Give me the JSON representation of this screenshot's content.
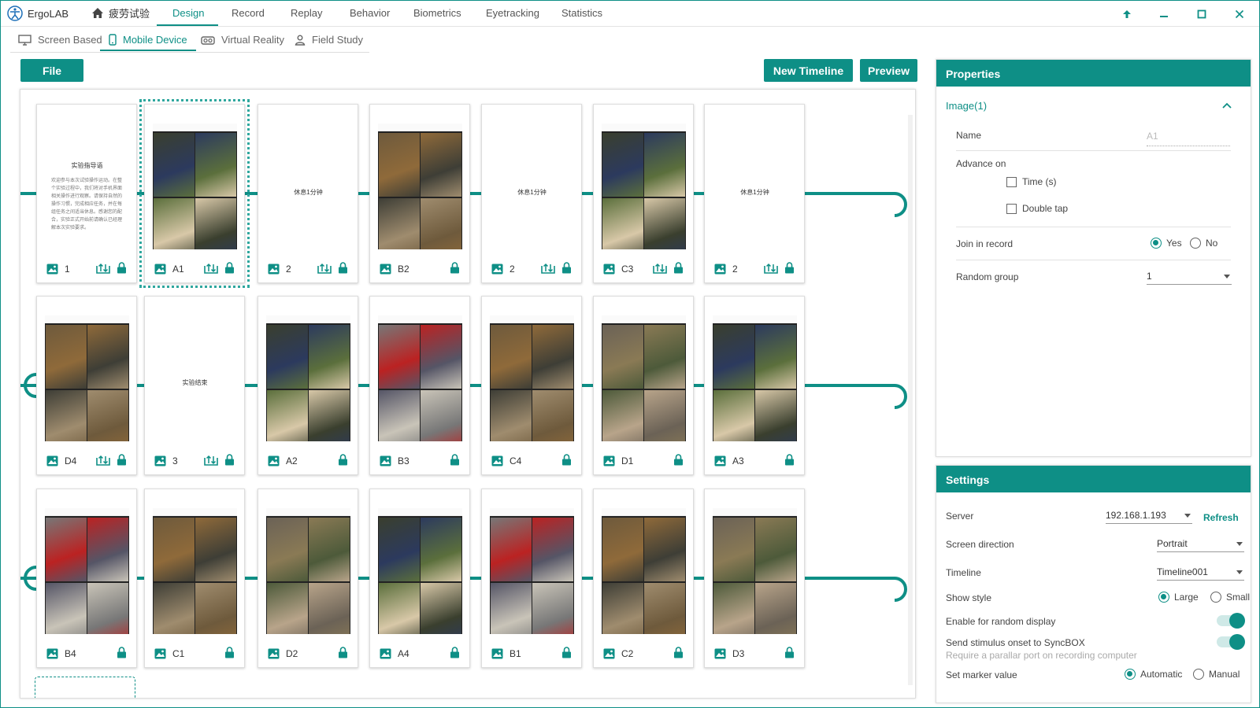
{
  "app": {
    "brand": "ErgoLAB",
    "project": "疲劳试验"
  },
  "nav": [
    "Design",
    "Record",
    "Replay",
    "Behavior",
    "Biometrics",
    "Eyetracking",
    "Statistics"
  ],
  "subtabs": [
    "Screen Based",
    "Mobile Device",
    "Virtual Reality",
    "Field Study"
  ],
  "toolbar": {
    "file": "File",
    "new_timeline": "New Timeline",
    "preview": "Preview"
  },
  "cards": {
    "row1": [
      "1",
      "A1",
      "2",
      "B2",
      "2",
      "C3",
      "2"
    ],
    "row2": [
      "D4",
      "3",
      "A2",
      "B3",
      "C4",
      "D1",
      "A3"
    ],
    "row3": [
      "B4",
      "C1",
      "D2",
      "A4",
      "B1",
      "C2",
      "D3"
    ]
  },
  "slide_text": {
    "intro_title": "实验指导语",
    "intro_body": "欢迎参与本次试验操作运动。在整个实验过程中，我们将对手机界面相关操作进行观察。请保持自然的操作习惯，完成相应任务，并在每组任务之间适当休息。感谢您的配合，实验正式开始前请确认已经理解本次实验要求。",
    "rest": "休息1分钟",
    "end": "实验结束"
  },
  "properties": {
    "title": "Properties",
    "section": "Image(1)",
    "name_label": "Name",
    "name_placeholder": "A1",
    "advance_label": "Advance on",
    "time_label": "Time (s)",
    "double_tap_label": "Double tap",
    "join_label": "Join in record",
    "yes": "Yes",
    "no": "No",
    "random_label": "Random group",
    "random_value": "1"
  },
  "settings": {
    "title": "Settings",
    "server_label": "Server",
    "server_value": "192.168.1.193",
    "refresh": "Refresh",
    "screen_label": "Screen direction",
    "screen_value": "Portrait",
    "timeline_label": "Timeline",
    "timeline_value": "Timeline001",
    "show_label": "Show style",
    "large": "Large",
    "small": "Small",
    "random_display": "Enable for random display",
    "sync_label": "Send stimulus onset to SyncBOX",
    "sync_hint": "Require a parallar port on recording computer",
    "marker_label": "Set marker value",
    "automatic": "Automatic",
    "manual": "Manual"
  },
  "colors": {
    "accent": "#0e8f86"
  }
}
